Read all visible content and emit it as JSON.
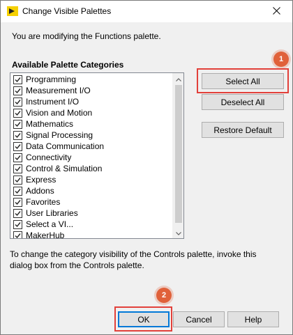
{
  "window": {
    "title": "Change Visible Palettes"
  },
  "message": "You are modifying the Functions palette.",
  "categories": {
    "label": "Available Palette Categories",
    "items": [
      {
        "label": "Programming",
        "checked": true
      },
      {
        "label": "Measurement I/O",
        "checked": true
      },
      {
        "label": "Instrument I/O",
        "checked": true
      },
      {
        "label": "Vision and Motion",
        "checked": true
      },
      {
        "label": "Mathematics",
        "checked": true
      },
      {
        "label": "Signal Processing",
        "checked": true
      },
      {
        "label": "Data Communication",
        "checked": true
      },
      {
        "label": "Connectivity",
        "checked": true
      },
      {
        "label": "Control & Simulation",
        "checked": true
      },
      {
        "label": "Express",
        "checked": true
      },
      {
        "label": "Addons",
        "checked": true
      },
      {
        "label": "Favorites",
        "checked": true
      },
      {
        "label": "User Libraries",
        "checked": true
      },
      {
        "label": "Select a VI...",
        "checked": true
      },
      {
        "label": "MakerHub",
        "checked": true
      }
    ]
  },
  "buttons": {
    "select_all": "Select All",
    "deselect_all": "Deselect All",
    "restore_default": "Restore Default",
    "ok": "OK",
    "cancel": "Cancel",
    "help": "Help"
  },
  "note": "To change the category visibility of the Controls palette, invoke this dialog box from the Controls palette.",
  "callouts": {
    "step1": "1",
    "step2": "2"
  },
  "colors": {
    "callout": "#e2403a",
    "badge": "#e0613a",
    "default_button_border": "#0078d7"
  }
}
